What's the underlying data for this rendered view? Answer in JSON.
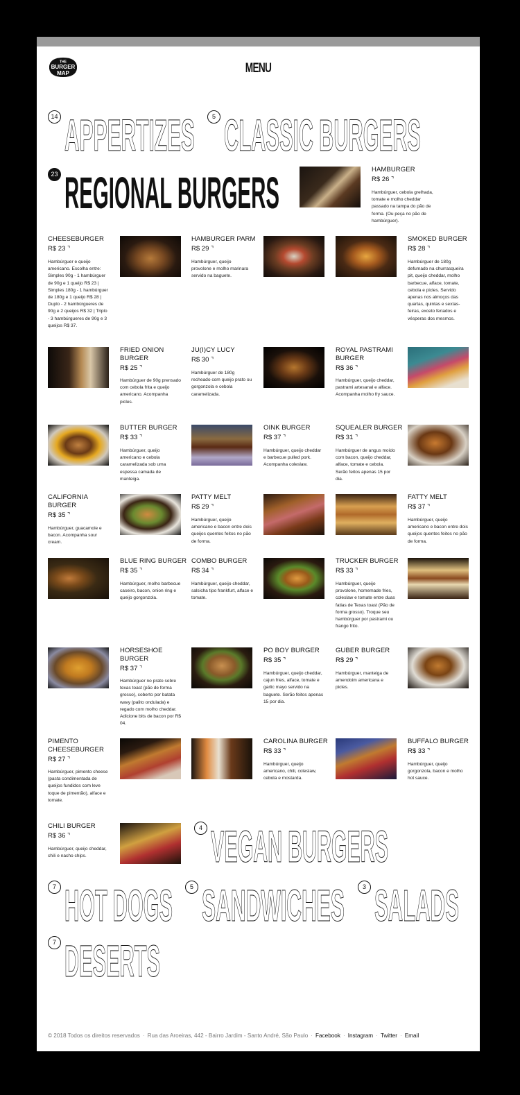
{
  "menu_title": "MENU",
  "logo_text": [
    "THE",
    "BURGER",
    "MAP"
  ],
  "categories": [
    {
      "count": "14",
      "label": "APPERTIZES",
      "active": false
    },
    {
      "count": "5",
      "label": "CLASSIC BURGERS",
      "active": false
    },
    {
      "count": "23",
      "label": "REGIONAL BURGERS",
      "active": true
    },
    {
      "count": "4",
      "label": "VEGAN BURGERS",
      "active": false
    },
    {
      "count": "7",
      "label": "HOT DOGS",
      "active": false
    },
    {
      "count": "5",
      "label": "SANDWICHES",
      "active": false
    },
    {
      "count": "3",
      "label": "SALADS",
      "active": false
    },
    {
      "count": "7",
      "label": "DESERTS",
      "active": false
    }
  ],
  "items": [
    {
      "name": "HAMBURGER",
      "price": "R$ 26",
      "desc": "Hambúrguer, cebola grelhada, tomate e molho cheddar passado na tampa do pão de forma. (Ou peça no pão de hambúrguer)."
    },
    {
      "name": "CHEESEBURGER",
      "price": "R$ 23",
      "desc": "Hambúrguer e queijo americano. Escolha entre: Simples 90g - 1 hambúrguer de 90g e 1 queijo R$ 23 | Simples 180g - 1 hambúrguer de 180g e 1 queijo R$ 28 | Duplo - 2 hambúrgueres de 90g e 2 queijos R$ 32 | Triplo - 3 hambúrgueres de 90g e 3 queijos R$ 37."
    },
    {
      "name": "HAMBURGER PARM",
      "price": "R$ 29",
      "desc": "Hambúrguer, queijo provolone e molho marinara servido na baguete."
    },
    {
      "name": "SMOKED BURGER",
      "price": "R$ 28",
      "desc": "Hambúrguer de 180g defumado na churrasqueira pit, queijo cheddar, molho barbecue, alface, tomate, cebola e picles. Servido apenas nos almoços das quartas, quintas e sextas-feiras, exceto feriados e vésperas dos mesmos."
    },
    {
      "name": "FRIED ONION BURGER",
      "price": "R$ 25",
      "desc": "Hambúrguer de 90g prensado com cebola frita e queijo americano. Acompanha picles."
    },
    {
      "name": "JU(I)CY LUCY",
      "price": "R$ 30",
      "desc": "Hambúrguer de 180g recheado com queijo prato ou gorgonzola e cebola caramelizada."
    },
    {
      "name": "ROYAL PASTRAMI BURGER",
      "price": "R$ 36",
      "desc": "Hambúrguer, queijo cheddar, pastrami artesanal e alface. Acompanha molho fry sauce."
    },
    {
      "name": "BUTTER BURGER",
      "price": "R$ 33",
      "desc": "Hambúrguer, queijo americano e cebola caramelizada sob uma espessa camada de manteiga."
    },
    {
      "name": "OINK BURGER",
      "price": "R$ 37",
      "desc": "Hambúrguer, queijo cheddar e barbecue pulled pork. Acompanha coleslaw."
    },
    {
      "name": "SQUEALER BURGER",
      "price": "R$ 31",
      "desc": "Hambúrguer de angus moído com bacon, queijo cheddar, alface, tomate e cebola. Serão feitos apenas 15 por dia."
    },
    {
      "name": "CALIFORNIA BURGER",
      "price": "R$ 35",
      "desc": "Hambúrguer, guacamole e bacon. Acompanha sour cream."
    },
    {
      "name": "PATTY MELT",
      "price": "R$ 29",
      "desc": "Hambúrguer, queijo americano e bacon entre dois queijos quentes feitos no pão de forma."
    },
    {
      "name": "FATTY MELT",
      "price": "R$ 37",
      "desc": "Hambúrguer, queijo americano e bacon entre dois queijos quentes feitos no pão de forma."
    },
    {
      "name": "BLUE RING BURGER",
      "price": "R$ 35",
      "desc": "Hambúrguer, molho barbecue caseiro, bacon, onion ring e queijo gorgonzola."
    },
    {
      "name": "COMBO BURGER",
      "price": "R$ 34",
      "desc": "Hambúrguer, queijo cheddar, salsicha tipo frankfurt, alface e tomate."
    },
    {
      "name": "TRUCKER BURGER",
      "price": "R$ 33",
      "desc": "Hambúrguer, queijo provolone, homemade fries, coleslaw e tomate entre duas fatias de Texas toast (Pão de forma grosso). Troque seu hambúrguer por pastrami ou frango frito."
    },
    {
      "name": "HORSESHOE BURGER",
      "price": "R$ 37",
      "desc": "Hambúrguer no prato sobre texas toast (pão de forma grosso), coberto por batata wavy (palito ondulada) e regado com molho cheddar. Adicione bits de bacon por R$ 04."
    },
    {
      "name": "PO BOY BURGER",
      "price": "R$ 35",
      "desc": "Hambúrguer, queijo cheddar, cajun fries, alface, tomate e garlic mayo servido na baguete. Serão feitos apenas 15 por dia."
    },
    {
      "name": "GUBER BURGER",
      "price": "R$ 29",
      "desc": "Hambúrguer, manteiga de amendoim americana e picles."
    },
    {
      "name": "PIMENTO CHEESEBURGER",
      "price": "R$ 27",
      "desc": "Hambúrguer, pimento cheese (pasta condimentada de queijos fundidos com leve toque de pimentão), alface e tomate."
    },
    {
      "name": "CAROLINA BURGER",
      "price": "R$ 33",
      "desc": "Hambúrguer, queijo americano, chili, coleslaw, cebola e mostarda."
    },
    {
      "name": "BUFFALO BURGER",
      "price": "R$ 33",
      "desc": "Hambúrguer, queijo gorgonzola, bacon e molho hot sauce."
    },
    {
      "name": "CHILI BURGER",
      "price": "R$ 36",
      "desc": "Hambúrguer, queijo cheddar, chili e nacho chips."
    }
  ],
  "footer": {
    "copyright": "© 2018 Todos os direitos reservados",
    "address": "Rua das Aroeiras, 442 - Bairro Jardim - Santo André, São Paulo",
    "links": [
      "Facebook",
      "Instagram",
      "Twitter",
      "Email"
    ],
    "separator": "·"
  }
}
